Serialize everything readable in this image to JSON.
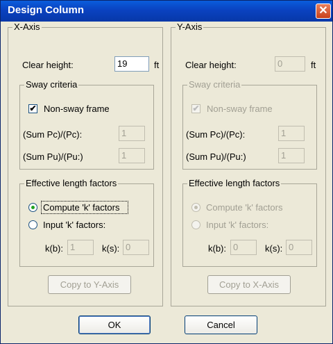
{
  "window": {
    "title": "Design Column",
    "close_icon": "close-icon"
  },
  "x_axis": {
    "legend": "X-Axis",
    "clear_height": {
      "label": "Clear height:",
      "value": "19",
      "unit": "ft"
    },
    "sway": {
      "legend": "Sway criteria",
      "non_sway_label": "Non-sway frame",
      "non_sway_checked": true,
      "sum_pc_label": "(Sum Pc)/(Pc):",
      "sum_pc_value": "1",
      "sum_pu_label": "(Sum Pu)/(Pu:)",
      "sum_pu_value": "1"
    },
    "elf": {
      "legend": "Effective length factors",
      "compute_label": "Compute 'k' factors",
      "input_label": "Input 'k' factors:",
      "selected": "compute",
      "kb_label": "k(b):",
      "kb_value": "1",
      "ks_label": "k(s):",
      "ks_value": "0"
    },
    "copy_label": "Copy to Y-Axis"
  },
  "y_axis": {
    "legend": "Y-Axis",
    "clear_height": {
      "label": "Clear height:",
      "value": "0",
      "unit": "ft"
    },
    "sway": {
      "legend": "Sway criteria",
      "non_sway_label": "Non-sway frame",
      "non_sway_checked": true,
      "sum_pc_label": "(Sum Pc)/(Pc):",
      "sum_pc_value": "1",
      "sum_pu_label": "(Sum Pu)/(Pu:)",
      "sum_pu_value": "1"
    },
    "elf": {
      "legend": "Effective length factors",
      "compute_label": "Compute 'k' factors",
      "input_label": "Input 'k' factors:",
      "selected": "compute",
      "kb_label": "k(b):",
      "kb_value": "0",
      "ks_label": "k(s):",
      "ks_value": "0"
    },
    "copy_label": "Copy to X-Axis"
  },
  "buttons": {
    "ok": "OK",
    "cancel": "Cancel"
  },
  "colors": {
    "titlebar": "#0a42c0",
    "dialog_bg": "#ece9d8",
    "disabled_text": "#a19f93"
  }
}
